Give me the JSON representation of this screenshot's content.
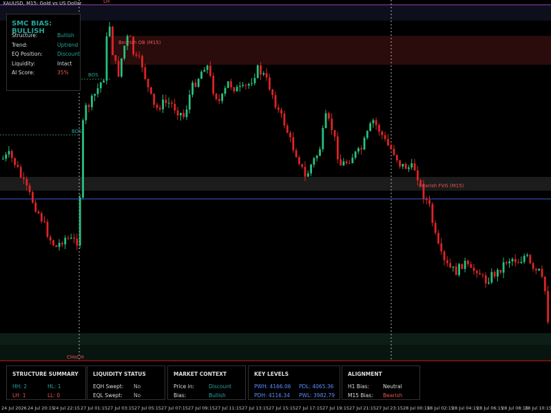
{
  "window": {
    "title": "XAUUSD, M15:  Gold vs US Dollar"
  },
  "colors": {
    "bull": "#26c281",
    "bear": "#e02424",
    "teal": "#26a69a",
    "blue": "#5b8dff",
    "red": "#ef5350"
  },
  "bias_panel": {
    "header": "SMC BIAS: BULLISH",
    "rows": [
      {
        "label": "Structure:",
        "value": "Bullish",
        "color": "#26a69a"
      },
      {
        "label": "Trend:",
        "value": "Uptrend",
        "color": "#26a69a"
      },
      {
        "label": "EQ Position:",
        "value": "Discount",
        "color": "#26a69a"
      },
      {
        "label": "Liquidity:",
        "value": "Intact",
        "color": "#dddddd"
      },
      {
        "label": "AI Score:",
        "value": "35%",
        "color": "#ef5350"
      }
    ]
  },
  "chart_labels": {
    "lh": "LH",
    "bos1": "BOS",
    "bos2": "BOS",
    "bearish_ob": "Bearish OB (M15)",
    "bearish_fvg": "Bearish FVG (M15)",
    "choch": "CHoCH"
  },
  "summary": {
    "structure": {
      "title": "STRUCTURE SUMMARY",
      "hh": "HH: 2",
      "hl": "HL: 1",
      "lh": "LH: 1",
      "ll": "LL: 0"
    },
    "liquidity": {
      "title": "LIQUIDITY STATUS",
      "eqh_label": "EQH Swept:",
      "eqh_value": "No",
      "eql_label": "EQL Swept:",
      "eql_value": "No"
    },
    "market": {
      "title": "MARKET CONTEXT",
      "price_label": "Price in:",
      "price_value": "Discount",
      "bias_label": "Bias:",
      "bias_value": "Bullish"
    },
    "levels": {
      "title": "KEY LEVELS",
      "pwh": "PWH: 4166.06",
      "pdl": "PDL: 4065.36",
      "pdh": "PDH: 4116.34",
      "pwl": "PWL: 3982.79"
    },
    "alignment": {
      "title": "ALIGNMENT",
      "h1_label": "H1 Bias:",
      "h1_value": "Neutral",
      "m15_label": "M15 Bias:",
      "m15_value": "Bearish"
    }
  },
  "time_axis": [
    "24 Jul 2026",
    "24 Jul 20:15",
    "24 Jul 22:15",
    "27 Jul 01:15",
    "27 Jul 03:15",
    "27 Jul 05:15",
    "27 Jul 07:15",
    "27 Jul 09:15",
    "27 Jul 11:15",
    "27 Jul 13:15",
    "27 Jul 15:15",
    "27 Jul 17:15",
    "27 Jul 19:15",
    "27 Jul 21:15",
    "27 Jul 23:15",
    "28 Jul 00:15",
    "28 Jul 02:15",
    "28 Jul 04:15",
    "28 Jul 06:15",
    "28 Jul 08:15",
    "28 Jul 10:15"
  ]
}
